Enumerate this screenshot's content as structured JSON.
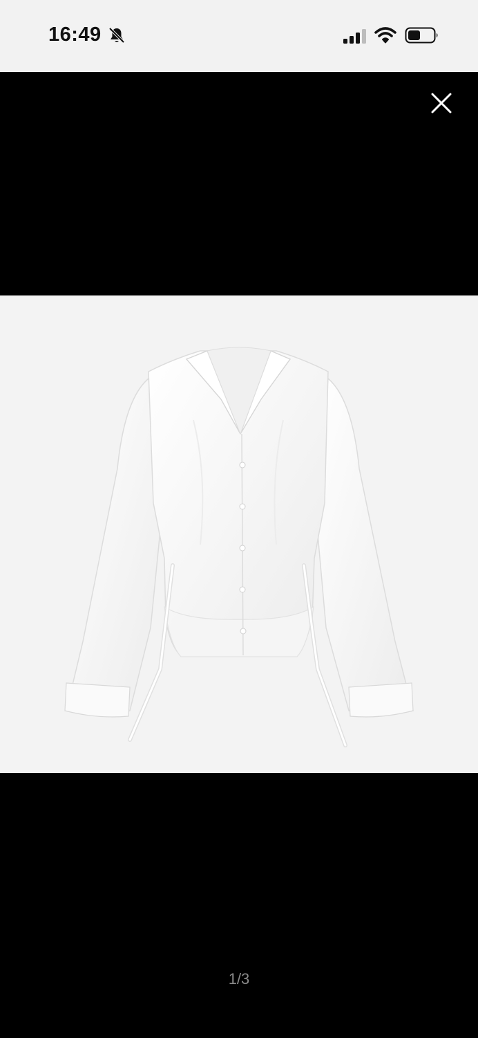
{
  "status_bar": {
    "time": "16:49",
    "silent_icon": "bell-slash-icon",
    "signal_icon": "cellular-signal-icon",
    "wifi_icon": "wifi-icon",
    "battery_icon": "battery-icon"
  },
  "viewer": {
    "close_icon": "close-icon",
    "image_subject": "white-button-up-shirt-photo",
    "page_counter": "1/3"
  },
  "colors": {
    "status_bar_bg": "#f2f2f2",
    "viewer_bg": "#000000",
    "photo_bg": "#f3f3f3",
    "counter_text": "#8a8a8a"
  }
}
